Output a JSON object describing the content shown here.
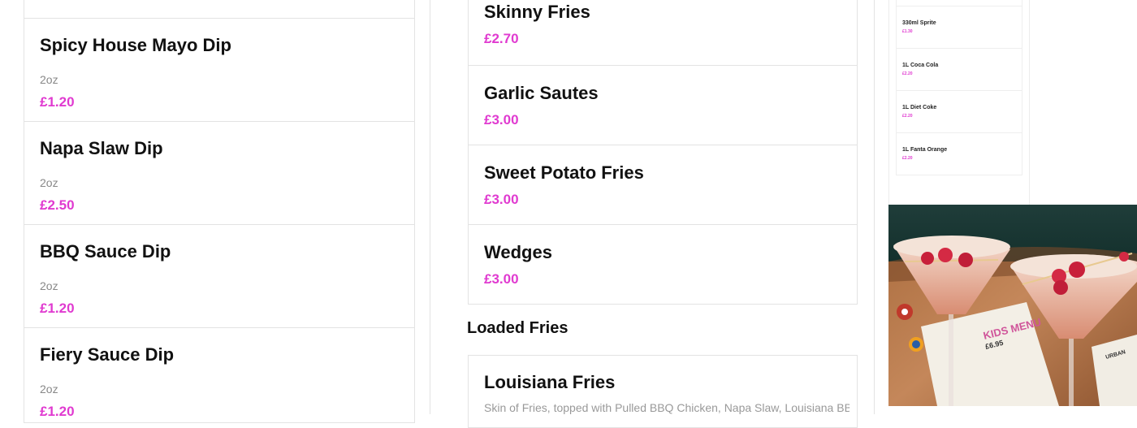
{
  "dips": [
    {
      "name": "Spicy House Mayo Dip",
      "desc": "2oz",
      "price": "£1.20"
    },
    {
      "name": "Napa Slaw Dip",
      "desc": "2oz",
      "price": "£2.50"
    },
    {
      "name": "BBQ Sauce Dip",
      "desc": "2oz",
      "price": "£1.20"
    },
    {
      "name": "Fiery Sauce Dip",
      "desc": "2oz",
      "price": "£1.20"
    }
  ],
  "sides": [
    {
      "name": "Skinny Fries",
      "price": "£2.70"
    },
    {
      "name": "Garlic Sautes",
      "price": "£3.00"
    },
    {
      "name": "Sweet Potato Fries",
      "price": "£3.00"
    },
    {
      "name": "Wedges",
      "price": "£3.00"
    }
  ],
  "loaded": {
    "title": "Loaded Fries",
    "items": [
      {
        "name": "Louisiana Fries",
        "desc": "Skin of Fries, topped with Pulled BBQ Chicken, Napa Slaw, Louisiana BBQ"
      }
    ]
  },
  "drinks": [
    {
      "name": "330ml Sprite",
      "price": "£1.30"
    },
    {
      "name": "1L Coca Cola",
      "price": "£2.20"
    },
    {
      "name": "1L Diet Coke",
      "price": "£2.20"
    },
    {
      "name": "1L Fanta Orange",
      "price": "£2.20"
    }
  ],
  "photo": {
    "menu_title": "KIDS MENU",
    "menu_price": "£6.95",
    "brand": "URBAN"
  },
  "colors": {
    "price": "#e03ad0",
    "border": "#e3e3e3"
  }
}
